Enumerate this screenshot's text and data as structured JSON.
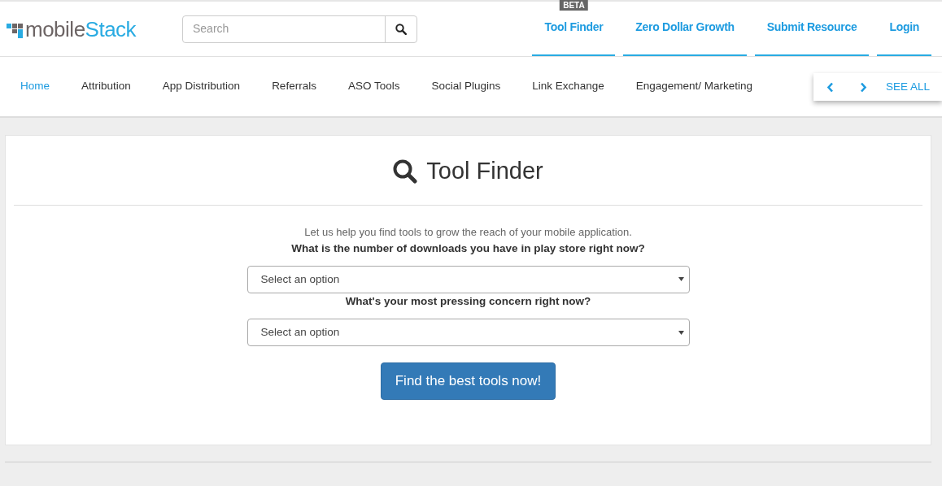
{
  "logo": {
    "part_1": "mobile",
    "part_2": "Stack"
  },
  "search": {
    "placeholder": "Search"
  },
  "top_links": [
    {
      "label": "Tool Finder",
      "badge": "BETA"
    },
    {
      "label": "Zero Dollar Growth"
    },
    {
      "label": "Submit Resource"
    },
    {
      "label": "Login"
    }
  ],
  "nav": [
    {
      "label": "Home",
      "selected": true
    },
    {
      "label": "Attribution",
      "selected": false
    },
    {
      "label": "App Distribution",
      "selected": false
    },
    {
      "label": "Referrals",
      "selected": false
    },
    {
      "label": "ASO Tools",
      "selected": false
    },
    {
      "label": "Social Plugins",
      "selected": false
    },
    {
      "label": "Link Exchange",
      "selected": false
    },
    {
      "label": "Engagement/ Marketing",
      "selected": false
    }
  ],
  "nav_controls": {
    "see_all": "SEE ALL"
  },
  "tool_finder": {
    "title": "Tool Finder",
    "intro": "Let us help you find tools to grow the reach of your mobile application.",
    "questions": [
      {
        "label": "What is the number of downloads you have in play store right now?",
        "value": "Select an option"
      },
      {
        "label": "What's your most pressing concern right now?",
        "value": "Select an option"
      }
    ],
    "button": "Find the best tools now!"
  }
}
